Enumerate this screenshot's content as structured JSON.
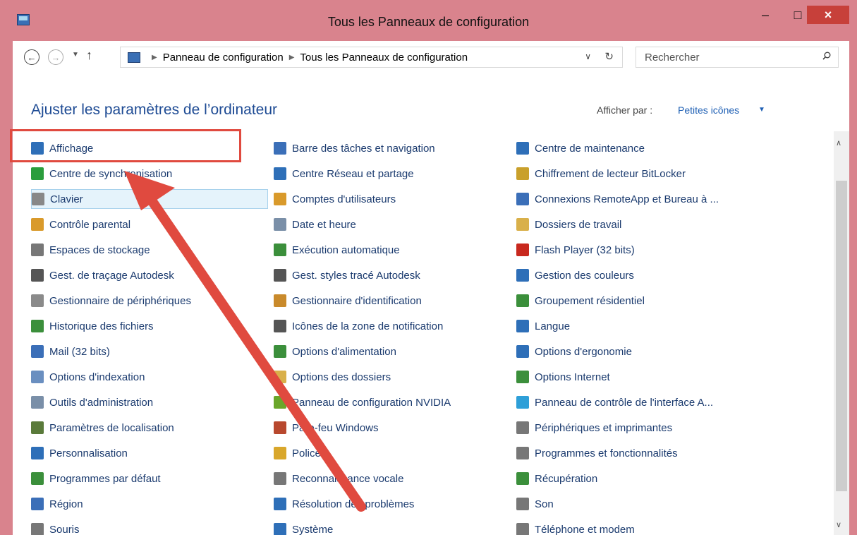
{
  "window": {
    "title": "Tous les Panneaux de configuration",
    "minimize": "–",
    "maximize": "□",
    "close": "×"
  },
  "nav": {
    "back": "←",
    "forward": "→",
    "recent": "▼",
    "up": "↑"
  },
  "address": {
    "root": "Panneau de configuration",
    "current": "Tous les Panneaux de configuration",
    "drop": "∨",
    "refresh": "↻"
  },
  "search": {
    "placeholder": "Rechercher"
  },
  "header": {
    "title": "Ajuster les paramètres de l’ordinateur",
    "viewby_label": "Afficher par :",
    "viewby_value": "Petites icônes",
    "viewby_arrow": "▼"
  },
  "columns": [
    [
      {
        "label": "Affichage",
        "icon": "monitor-icon",
        "color": "#2e6fb8"
      },
      {
        "label": "Centre de synchronisation",
        "icon": "sync-icon",
        "color": "#2a9d3c"
      },
      {
        "label": "Clavier",
        "icon": "keyboard-icon",
        "color": "#888888"
      },
      {
        "label": "Contrôle parental",
        "icon": "family-icon",
        "color": "#d99a2b"
      },
      {
        "label": "Espaces de stockage",
        "icon": "storage-icon",
        "color": "#777777"
      },
      {
        "label": "Gest. de traçage Autodesk",
        "icon": "plotter-icon",
        "color": "#555555"
      },
      {
        "label": "Gestionnaire de périphériques",
        "icon": "devices-icon",
        "color": "#8a8a8a"
      },
      {
        "label": "Historique des fichiers",
        "icon": "history-icon",
        "color": "#3b8f3b"
      },
      {
        "label": "Mail (32 bits)",
        "icon": "mail-icon",
        "color": "#3b6fb8"
      },
      {
        "label": "Options d'indexation",
        "icon": "index-icon",
        "color": "#6a8fc0"
      },
      {
        "label": "Outils d'administration",
        "icon": "admin-tools-icon",
        "color": "#7a8fa8"
      },
      {
        "label": "Paramètres de localisation",
        "icon": "location-icon",
        "color": "#5a7a3a"
      },
      {
        "label": "Personnalisation",
        "icon": "personalize-icon",
        "color": "#2e6fb8"
      },
      {
        "label": "Programmes par défaut",
        "icon": "default-programs-icon",
        "color": "#3b8f3b"
      },
      {
        "label": "Région",
        "icon": "region-icon",
        "color": "#3b6fb8"
      },
      {
        "label": "Souris",
        "icon": "mouse-icon",
        "color": "#777777"
      }
    ],
    [
      {
        "label": "Barre des tâches et navigation",
        "icon": "taskbar-icon",
        "color": "#3b6fb8"
      },
      {
        "label": "Centre Réseau et partage",
        "icon": "network-icon",
        "color": "#2e6fb8"
      },
      {
        "label": "Comptes d'utilisateurs",
        "icon": "users-icon",
        "color": "#d99a2b"
      },
      {
        "label": "Date et heure",
        "icon": "clock-icon",
        "color": "#7a8fa8"
      },
      {
        "label": "Exécution automatique",
        "icon": "autoplay-icon",
        "color": "#3b8f3b"
      },
      {
        "label": "Gest. styles tracé Autodesk",
        "icon": "plot-styles-icon",
        "color": "#555555"
      },
      {
        "label": "Gestionnaire d'identification",
        "icon": "credential-icon",
        "color": "#c98a2b"
      },
      {
        "label": "Icônes de la zone de notification",
        "icon": "notification-icon",
        "color": "#555555"
      },
      {
        "label": "Options d'alimentation",
        "icon": "power-icon",
        "color": "#3b8f3b"
      },
      {
        "label": "Options des dossiers",
        "icon": "folder-options-icon",
        "color": "#d9b04a"
      },
      {
        "label": "Panneau de configuration NVIDIA",
        "icon": "nvidia-icon",
        "color": "#6aa62a"
      },
      {
        "label": "Pare-feu Windows",
        "icon": "firewall-icon",
        "color": "#b8482e"
      },
      {
        "label": "Polices",
        "icon": "fonts-icon",
        "color": "#d9a72b"
      },
      {
        "label": "Reconnaissance vocale",
        "icon": "microphone-icon",
        "color": "#777777"
      },
      {
        "label": "Résolution des problèmes",
        "icon": "troubleshoot-icon",
        "color": "#2e6fb8"
      },
      {
        "label": "Système",
        "icon": "system-icon",
        "color": "#2e6fb8"
      }
    ],
    [
      {
        "label": "Centre de maintenance",
        "icon": "flag-icon",
        "color": "#2e6fb8"
      },
      {
        "label": "Chiffrement de lecteur BitLocker",
        "icon": "bitlocker-icon",
        "color": "#c9a02b"
      },
      {
        "label": "Connexions RemoteApp et Bureau à ...",
        "icon": "remoteapp-icon",
        "color": "#3b6fb8"
      },
      {
        "label": "Dossiers de travail",
        "icon": "work-folders-icon",
        "color": "#d9b04a"
      },
      {
        "label": "Flash Player (32 bits)",
        "icon": "flash-icon",
        "color": "#c8281e"
      },
      {
        "label": "Gestion des couleurs",
        "icon": "color-management-icon",
        "color": "#2e6fb8"
      },
      {
        "label": "Groupement résidentiel",
        "icon": "homegroup-icon",
        "color": "#3b8f3b"
      },
      {
        "label": "Langue",
        "icon": "language-icon",
        "color": "#2e6fb8"
      },
      {
        "label": "Options d'ergonomie",
        "icon": "ease-of-access-icon",
        "color": "#2e6fb8"
      },
      {
        "label": "Options Internet",
        "icon": "internet-options-icon",
        "color": "#3b8f3b"
      },
      {
        "label": "Panneau de contrôle de l'interface A...",
        "icon": "catalyst-icon",
        "color": "#2e9fd8"
      },
      {
        "label": "Périphériques et imprimantes",
        "icon": "printer-icon",
        "color": "#777777"
      },
      {
        "label": "Programmes et fonctionnalités",
        "icon": "programs-icon",
        "color": "#777777"
      },
      {
        "label": "Récupération",
        "icon": "recovery-icon",
        "color": "#3b8f3b"
      },
      {
        "label": "Son",
        "icon": "speaker-icon",
        "color": "#777777"
      },
      {
        "label": "Téléphone et modem",
        "icon": "phone-icon",
        "color": "#777777"
      }
    ]
  ],
  "scroll": {
    "up": "∧",
    "down": "∨"
  }
}
